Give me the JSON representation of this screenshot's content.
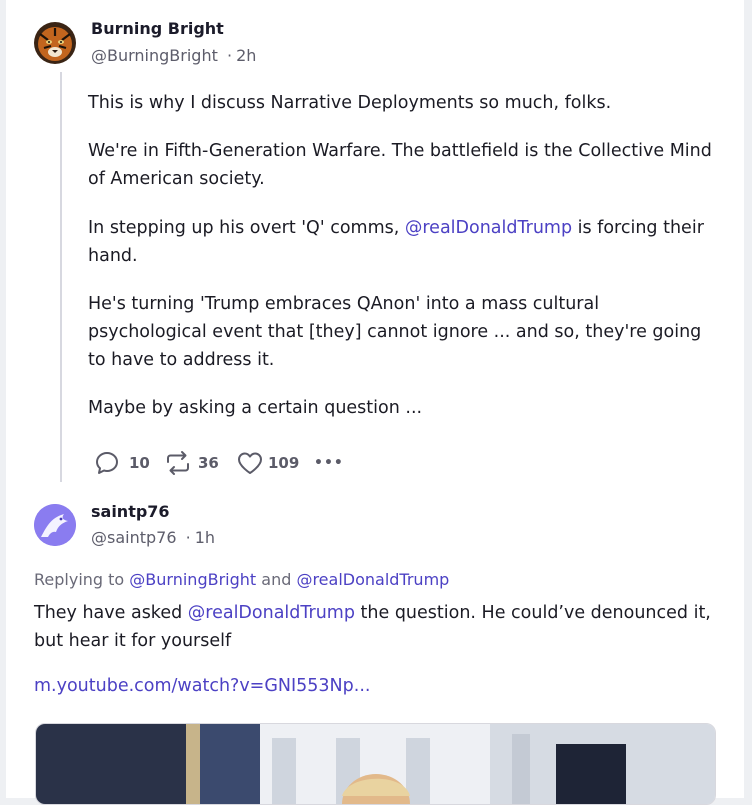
{
  "post": {
    "author_name": "Burning Bright",
    "author_handle": "@BurningBright",
    "separator": "·",
    "time": "2h",
    "p1": "This is why I discuss Narrative Deployments so much, folks.",
    "p2": "We're in Fifth-Generation Warfare. The battlefield is the Collective Mind of American society.",
    "p3_before": "In stepping up his overt 'Q' comms, ",
    "p3_mention": "@realDonaldTrump",
    "p3_after": " is forcing their hand.",
    "p4": "He's turning 'Trump embraces QAnon' into a mass cultural psychological event that [they] cannot ignore ... and so, they're going to have to address it.",
    "p5": "Maybe by asking a certain question ...",
    "replies_count": "10",
    "reposts_count": "36",
    "likes_count": "109",
    "more_label": "•••"
  },
  "reply": {
    "author_name": "saintp76",
    "author_handle": "@saintp76",
    "separator": "·",
    "time": "1h",
    "replying_prefix": "Replying to ",
    "replying_to_1": "@BurningBright",
    "replying_and": " and ",
    "replying_to_2": "@realDonaldTrump",
    "text_before": "They have asked ",
    "text_mention": "@realDonaldTrump",
    "text_after": " the question. He could’ve denounced it, but hear it for yourself",
    "link": "m.youtube.com/watch?v=GNI553Np..."
  },
  "colors": {
    "accent": "#4c41c4",
    "text": "#1b1b24",
    "muted": "#5d5d6b",
    "thread_line": "#d7d8e0",
    "page_bg": "#eef0f3"
  },
  "icons": {
    "reply": "speech-bubble-icon",
    "repost": "repost-arrows-icon",
    "like": "heart-icon",
    "more": "more-dots-icon"
  }
}
